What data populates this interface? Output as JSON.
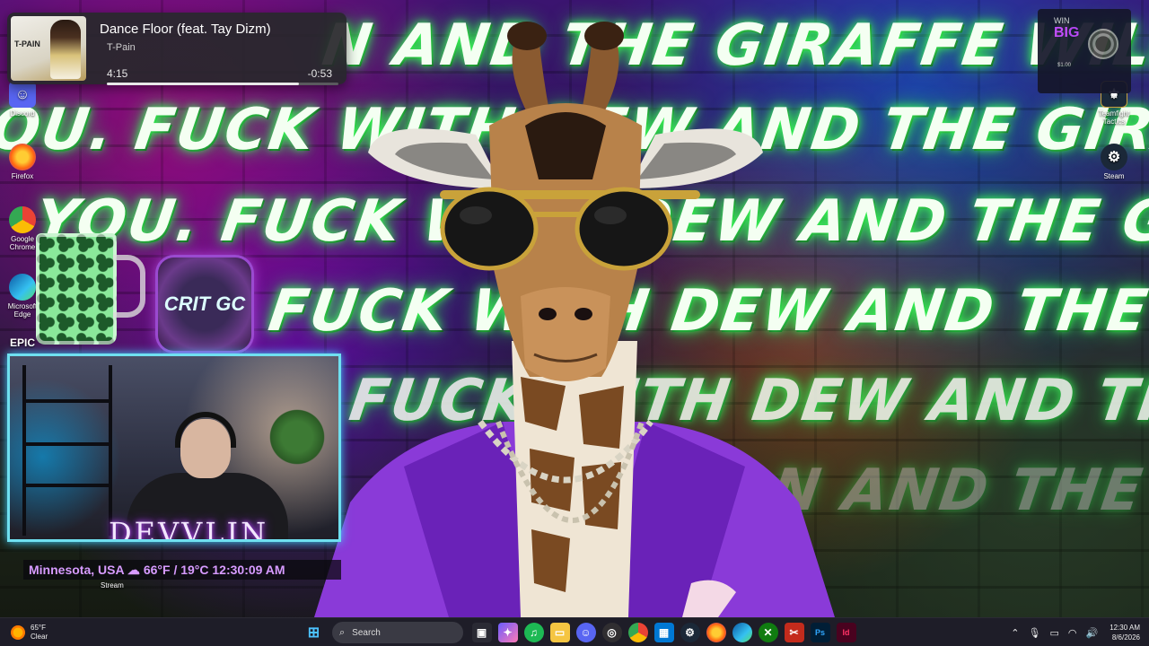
{
  "wallpaper": {
    "graffiti": [
      "N AND THE GIRAFFE WILL FIND",
      "OU. FUCK WITH DEW AND THE GIRAFFE WILL FIND Y",
      "YOU. FUCK WITH DEW AND THE GIRAFFE WILL FIN",
      "FUCK WITH DEW AND THE GIRAFFE WIL",
      "FUCK WITH DEW AND THE GIRAFFE",
      "N AND THE GIRA"
    ]
  },
  "media": {
    "title": "Dance Floor (feat. Tay Dizm)",
    "artist": "T-Pain",
    "elapsed": "4:15",
    "remaining": "-0:53",
    "progress_percent": 83,
    "art_label": "T-PAIN"
  },
  "desktop_icons": {
    "discord": "Discord",
    "firefox": "Firefox",
    "chrome": "Google Chrome",
    "edge": "Microsoft Edge",
    "epic": "EPIC",
    "teamfight": "Teamfight Tactics",
    "steam": "Steam"
  },
  "ad": {
    "win": "WIN",
    "big": "BIG",
    "price": "$1.00"
  },
  "logo": {
    "text": "CRIT GC"
  },
  "webcam": {
    "name": "DEVVLIN"
  },
  "location": {
    "text": "Minnesota, USA ☁ 66°F / 19°C 12:30:09 AM"
  },
  "stream_label": "Stream",
  "taskbar": {
    "weather_temp": "65°F",
    "weather_desc": "Clear",
    "search_placeholder": "Search",
    "time": "12:30 AM",
    "date": "8/6/2026"
  },
  "colors": {
    "graffiti_glow": "#3cff5a",
    "suit_purple": "#8a3ad8",
    "webcam_border": "#6fe0f0",
    "location_text": "#d79bff",
    "taskbar_bg": "#1e1e28"
  }
}
